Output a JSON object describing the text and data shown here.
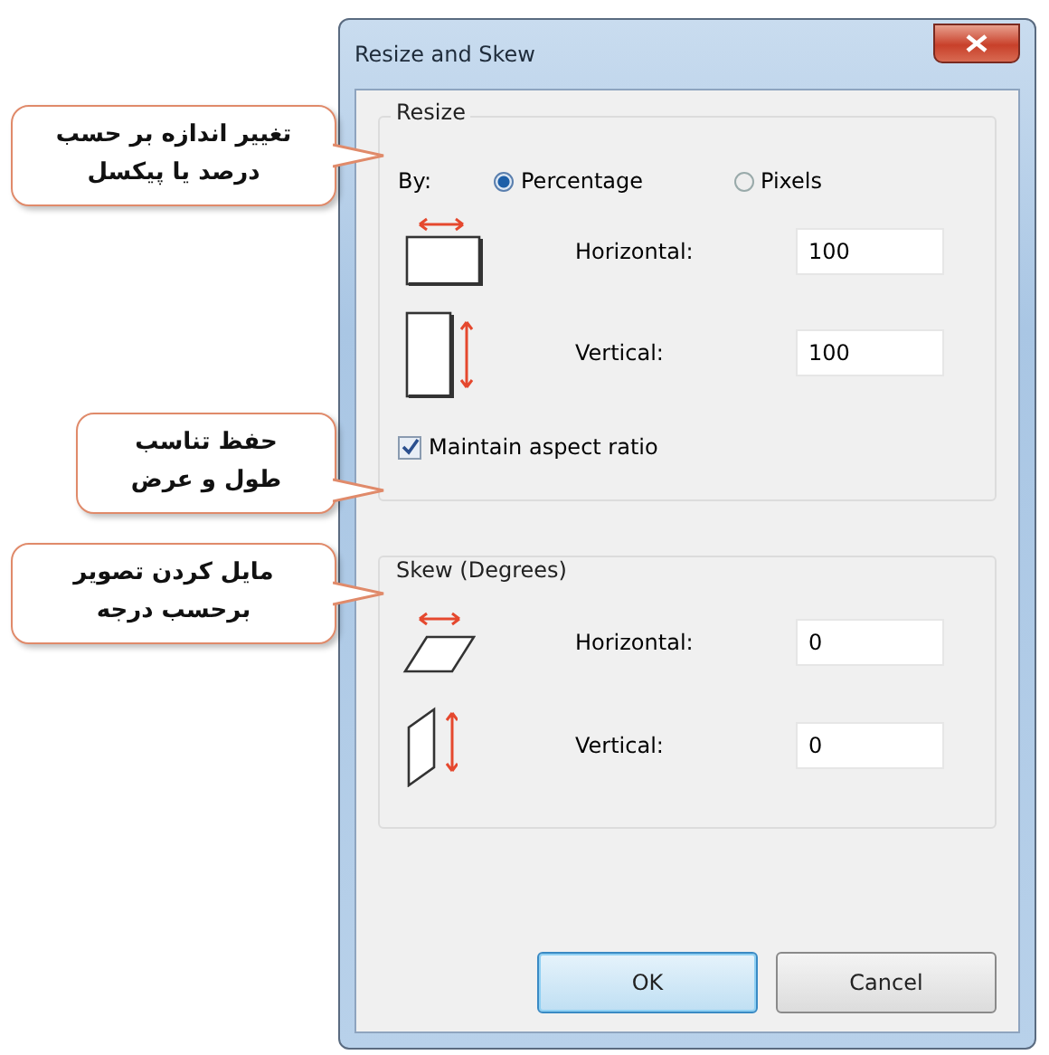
{
  "window": {
    "title": "Resize and Skew"
  },
  "resize": {
    "heading": "Resize",
    "by_label": "By:",
    "options": [
      {
        "label": "Percentage",
        "selected": true
      },
      {
        "label": "Pixels",
        "selected": false
      }
    ],
    "fields": [
      {
        "kind": "horizontal",
        "label": "Horizontal:",
        "value": "100"
      },
      {
        "kind": "vertical",
        "label": "Vertical:",
        "value": "100"
      }
    ],
    "aspect": {
      "label": "Maintain aspect ratio",
      "checked": true
    }
  },
  "skew": {
    "heading": "Skew (Degrees)",
    "fields": [
      {
        "kind": "skew-horizontal",
        "label": "Horizontal:",
        "value": "0"
      },
      {
        "kind": "skew-vertical",
        "label": "Vertical:",
        "value": "0"
      }
    ]
  },
  "buttons": [
    {
      "label": "OK",
      "kind": "default"
    },
    {
      "label": "Cancel",
      "kind": "normal"
    }
  ],
  "callouts": [
    {
      "text": "تغییر اندازه بر حسب\nدرصد یا پیکسل"
    },
    {
      "text": "حفظ تناسب\nطول و عرض"
    },
    {
      "text": "مایل کردن تصویر\nبرحسب درجه"
    }
  ]
}
